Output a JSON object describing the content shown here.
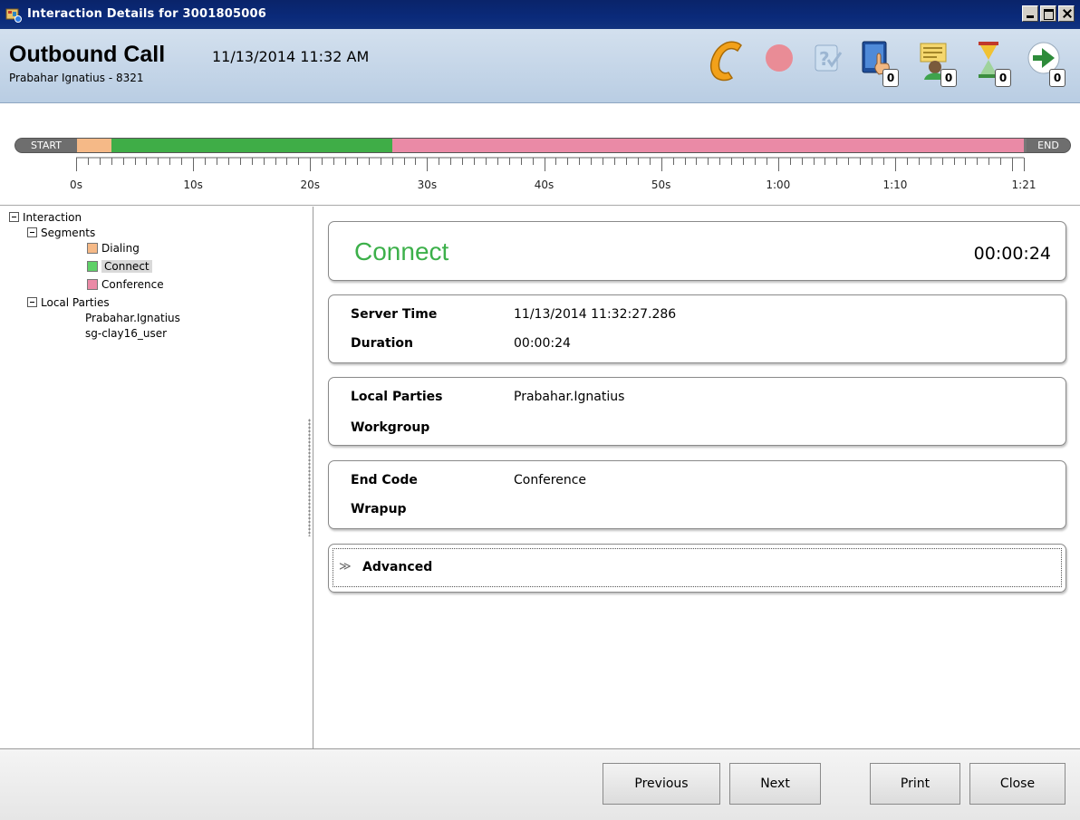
{
  "window": {
    "title": "Interaction Details for 3001805006"
  },
  "header": {
    "call_type": "Outbound Call",
    "call_datetime": "11/13/2014 11:32 AM",
    "party": "Prabahar Ignatius - 8321",
    "icons": [
      {
        "name": "phone-handset-icon",
        "badge": null
      },
      {
        "name": "record-icon",
        "badge": null
      },
      {
        "name": "help-check-icon",
        "badge": null
      },
      {
        "name": "tablet-touch-icon",
        "badge": "0"
      },
      {
        "name": "agent-notes-icon",
        "badge": "0"
      },
      {
        "name": "hourglass-icon",
        "badge": "0"
      },
      {
        "name": "transfer-arrow-icon",
        "badge": "0"
      }
    ]
  },
  "timeline": {
    "start_label": "START",
    "end_label": "END",
    "total_seconds": 81,
    "segments": [
      {
        "name": "Dialing",
        "start": 0,
        "end": 3,
        "color": "#f5b987"
      },
      {
        "name": "Connect",
        "start": 3,
        "end": 27,
        "color": "#3fad47"
      },
      {
        "name": "Conference",
        "start": 27,
        "end": 81,
        "color": "#ea8aa6"
      }
    ],
    "ticks": [
      {
        "label": "0s",
        "seconds": 0
      },
      {
        "label": "10s",
        "seconds": 10
      },
      {
        "label": "20s",
        "seconds": 20
      },
      {
        "label": "30s",
        "seconds": 30
      },
      {
        "label": "40s",
        "seconds": 40
      },
      {
        "label": "50s",
        "seconds": 50
      },
      {
        "label": "1:00",
        "seconds": 60
      },
      {
        "label": "1:10",
        "seconds": 70
      },
      {
        "label": "1:21",
        "seconds": 81
      }
    ]
  },
  "tree": {
    "root": "Interaction",
    "segments_label": "Segments",
    "segments": [
      {
        "label": "Dialing",
        "color": "#f5b987"
      },
      {
        "label": "Connect",
        "color": "#5fd068"
      },
      {
        "label": "Conference",
        "color": "#ea8aa6"
      }
    ],
    "local_parties_label": "Local Parties",
    "local_parties": [
      "Prabahar.Ignatius",
      "sg-clay16_user"
    ]
  },
  "detail": {
    "segment_name": "Connect",
    "segment_duration": "00:00:24",
    "server_time_label": "Server Time",
    "server_time_value": "11/13/2014 11:32:27.286",
    "duration_label": "Duration",
    "duration_value": "00:00:24",
    "local_parties_label": "Local Parties",
    "local_parties_value": "Prabahar.Ignatius",
    "workgroup_label": "Workgroup",
    "workgroup_value": "",
    "end_code_label": "End Code",
    "end_code_value": "Conference",
    "wrapup_label": "Wrapup",
    "wrapup_value": "",
    "advanced_label": "Advanced",
    "advanced_chevron": "≫"
  },
  "footer": {
    "previous": "Previous",
    "next": "Next",
    "print": "Print",
    "close": "Close"
  }
}
